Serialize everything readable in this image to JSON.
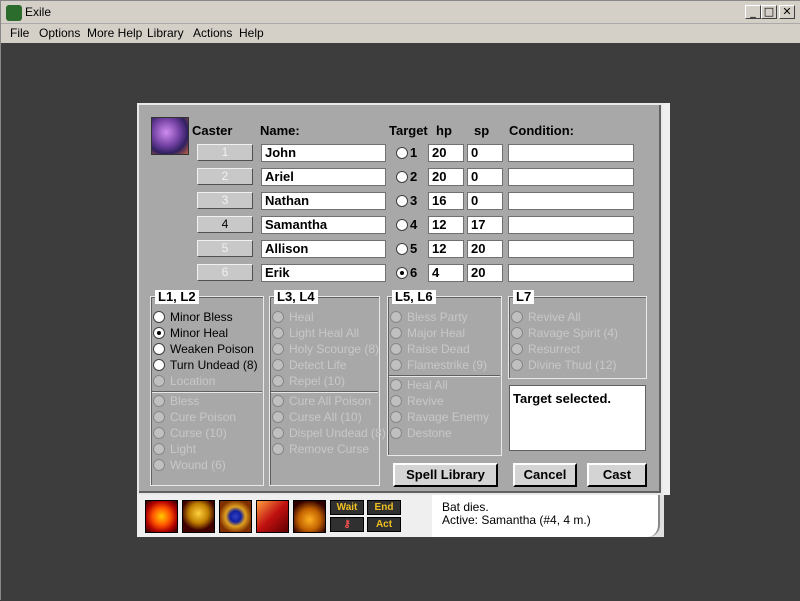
{
  "window": {
    "title": "Exile",
    "min": "_",
    "max": "□",
    "close": "✕"
  },
  "menu": [
    "File",
    "Options",
    "More Help",
    "Library",
    "Actions",
    "Help"
  ],
  "headers": {
    "caster": "Caster",
    "name": "Name:",
    "target": "Target",
    "hp": "hp",
    "sp": "sp",
    "condition": "Condition:"
  },
  "party": [
    {
      "slot": "1",
      "name": "John",
      "hp": "20",
      "sp": "0",
      "target_selected": false,
      "caster_active": false
    },
    {
      "slot": "2",
      "name": "Ariel",
      "hp": "20",
      "sp": "0",
      "target_selected": false,
      "caster_active": false
    },
    {
      "slot": "3",
      "name": "Nathan",
      "hp": "16",
      "sp": "0",
      "target_selected": false,
      "caster_active": false
    },
    {
      "slot": "4",
      "name": "Samantha",
      "hp": "12",
      "sp": "17",
      "target_selected": false,
      "caster_active": true
    },
    {
      "slot": "5",
      "name": "Allison",
      "hp": "12",
      "sp": "20",
      "target_selected": false,
      "caster_active": false
    },
    {
      "slot": "6",
      "name": "Erik",
      "hp": "4",
      "sp": "20",
      "target_selected": true,
      "caster_active": false
    }
  ],
  "spell_groups": {
    "g1": {
      "title": "L1, L2",
      "top": [
        {
          "label": "Minor Bless",
          "enabled": true,
          "checked": false
        },
        {
          "label": "Minor Heal",
          "enabled": true,
          "checked": true
        },
        {
          "label": "Weaken Poison",
          "enabled": true,
          "checked": false
        },
        {
          "label": "Turn Undead (8)",
          "enabled": true,
          "checked": false
        },
        {
          "label": "Location",
          "enabled": false,
          "checked": false
        }
      ],
      "bottom": [
        {
          "label": "Bless",
          "enabled": false,
          "checked": false
        },
        {
          "label": "Cure Poison",
          "enabled": false,
          "checked": false
        },
        {
          "label": "Curse (10)",
          "enabled": false,
          "checked": false
        },
        {
          "label": "Light",
          "enabled": false,
          "checked": false
        },
        {
          "label": "Wound (6)",
          "enabled": false,
          "checked": false
        }
      ]
    },
    "g2": {
      "title": "L3, L4",
      "top": [
        {
          "label": "Heal",
          "enabled": false,
          "checked": false
        },
        {
          "label": "Light Heal All",
          "enabled": false,
          "checked": false
        },
        {
          "label": "Holy Scourge (8)",
          "enabled": false,
          "checked": false
        },
        {
          "label": "Detect Life",
          "enabled": false,
          "checked": false
        },
        {
          "label": "Repel (10)",
          "enabled": false,
          "checked": false
        }
      ],
      "bottom": [
        {
          "label": "Cure All Poison",
          "enabled": false,
          "checked": false
        },
        {
          "label": "Curse All (10)",
          "enabled": false,
          "checked": false
        },
        {
          "label": "Dispel Undead (8)",
          "enabled": false,
          "checked": false
        },
        {
          "label": "Remove Curse",
          "enabled": false,
          "checked": false
        }
      ]
    },
    "g3": {
      "title": "L5, L6",
      "top": [
        {
          "label": "Bless Party",
          "enabled": false,
          "checked": false
        },
        {
          "label": "Major Heal",
          "enabled": false,
          "checked": false
        },
        {
          "label": "Raise Dead",
          "enabled": false,
          "checked": false
        },
        {
          "label": "Flamestrike (9)",
          "enabled": false,
          "checked": false
        }
      ],
      "bottom": [
        {
          "label": "Heal All",
          "enabled": false,
          "checked": false
        },
        {
          "label": "Revive",
          "enabled": false,
          "checked": false
        },
        {
          "label": "Ravage Enemy",
          "enabled": false,
          "checked": false
        },
        {
          "label": "Destone",
          "enabled": false,
          "checked": false
        }
      ]
    },
    "g4": {
      "title": "L7",
      "top": [
        {
          "label": "Revive All",
          "enabled": false,
          "checked": false
        },
        {
          "label": "Ravage Spirit (4)",
          "enabled": false,
          "checked": false
        },
        {
          "label": "Resurrect",
          "enabled": false,
          "checked": false
        },
        {
          "label": "Divine Thud (12)",
          "enabled": false,
          "checked": false
        }
      ]
    }
  },
  "info_text": "Target selected.",
  "buttons": {
    "spell_library": "Spell Library",
    "cancel": "Cancel",
    "cast": "Cast"
  },
  "toolbar": {
    "wait": "Wait",
    "end": "End",
    "act": "Act"
  },
  "log": [
    "Bat dies.",
    "Active:  Samantha (#4, 4 m.)"
  ]
}
